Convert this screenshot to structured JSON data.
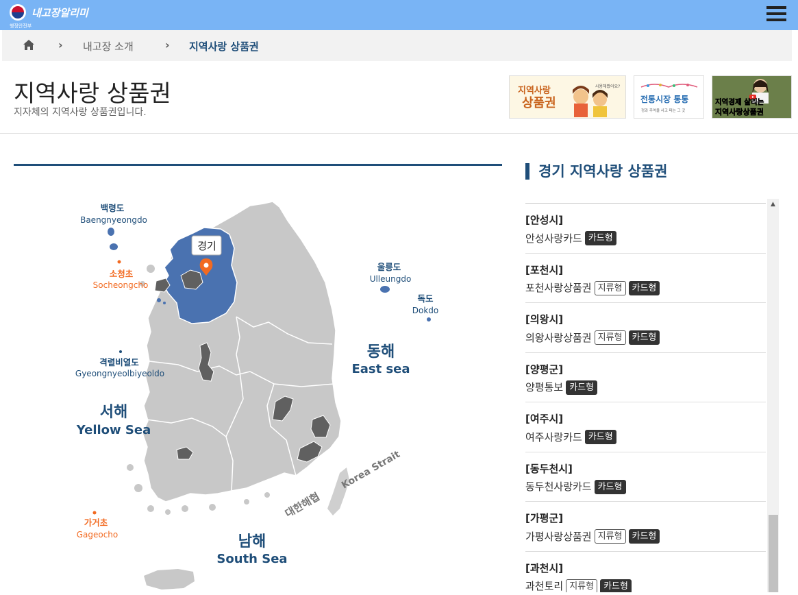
{
  "header": {
    "logo_text": "내고장알리미",
    "logo_sub": "행정안전부",
    "menu_icon": "hamburger-icon"
  },
  "breadcrumb": {
    "home_icon": "home-icon",
    "items": [
      "내고장 소개",
      "지역사랑 상품권"
    ]
  },
  "page": {
    "title": "지역사랑 상품권",
    "subtitle": "지자체의 지역사랑 상품권입니다."
  },
  "banners": [
    {
      "line1": "지역사랑",
      "line2": "상품권",
      "small": "사용해봤어요?"
    },
    {
      "title": "전통시장 통통",
      "sub": "정과 추억을 사고 파는 그 곳"
    },
    {
      "line1": "지역경제 살리는",
      "line2": "지역사랑상품권"
    }
  ],
  "map": {
    "selected_region": "경기",
    "islands": [
      {
        "ko": "백령도",
        "en": "Baengnyeongdo"
      },
      {
        "ko": "소청초",
        "en": "Socheongcho"
      },
      {
        "ko": "울릉도",
        "en": "Ulleungdo"
      },
      {
        "ko": "독도",
        "en": "Dokdo"
      },
      {
        "ko": "격렬비열도",
        "en": "Gyeongnyeolbiyeoldo"
      },
      {
        "ko": "가거초",
        "en": "Gageocho"
      }
    ],
    "seas": [
      {
        "ko": "동해",
        "en": "East sea"
      },
      {
        "ko": "서해",
        "en": "Yellow Sea"
      },
      {
        "ko": "남해",
        "en": "South Sea"
      }
    ],
    "strait": {
      "ko": "대한해협",
      "en": "Korea Strait"
    },
    "colors": {
      "land": "#c8c8c8",
      "selected": "#4a72b0",
      "dark": "#606060",
      "pin": "#f26a21",
      "label_blue": "#1f4e79",
      "label_orange": "#f26a21"
    }
  },
  "sidebar": {
    "title": "경기 지역사랑 상품권",
    "cities": [
      {
        "name": "[안성시]",
        "voucher": "안성사랑카드",
        "tags": [
          "카드형"
        ]
      },
      {
        "name": "[포천시]",
        "voucher": "포천사랑상품권",
        "tags": [
          "지류형",
          "카드형"
        ]
      },
      {
        "name": "[의왕시]",
        "voucher": "의왕사랑상품권",
        "tags": [
          "지류형",
          "카드형"
        ]
      },
      {
        "name": "[양평군]",
        "voucher": "양평통보",
        "tags": [
          "카드형"
        ]
      },
      {
        "name": "[여주시]",
        "voucher": "여주사랑카드",
        "tags": [
          "카드형"
        ]
      },
      {
        "name": "[동두천시]",
        "voucher": "동두천사랑카드",
        "tags": [
          "카드형"
        ]
      },
      {
        "name": "[가평군]",
        "voucher": "가평사랑상품권",
        "tags": [
          "지류형",
          "카드형"
        ]
      },
      {
        "name": "[과천시]",
        "voucher": "과천토리",
        "tags": [
          "지류형",
          "카드형"
        ]
      }
    ]
  }
}
